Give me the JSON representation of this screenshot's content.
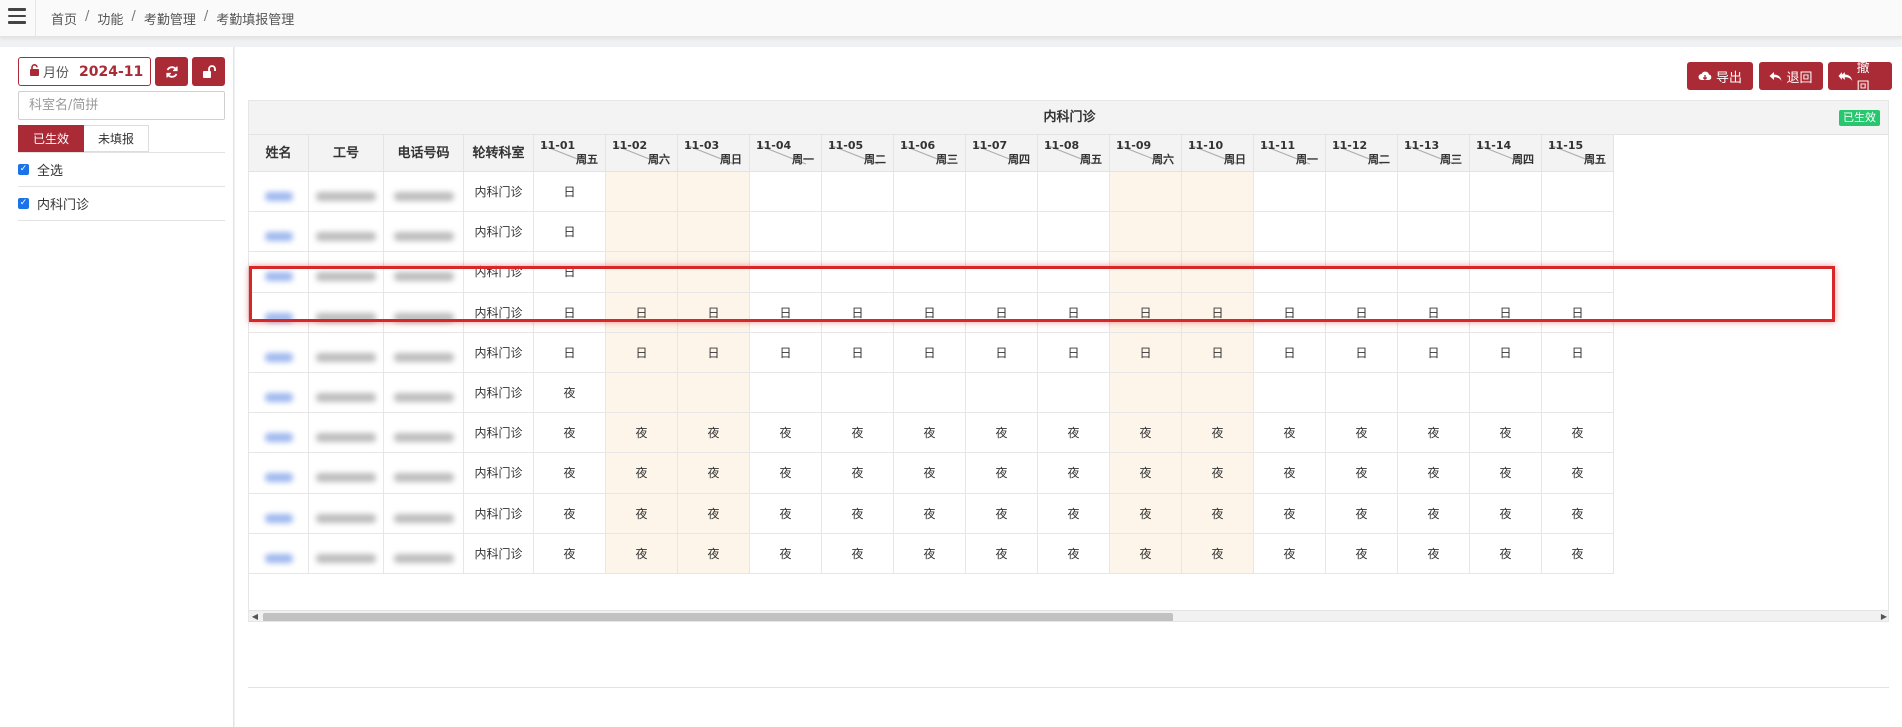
{
  "breadcrumb": [
    "首页",
    "功能",
    "考勤管理",
    "考勤填报管理"
  ],
  "sidebar": {
    "month_label": "月份",
    "month_value": "2024-11",
    "search_placeholder": "科室名/简拼",
    "tabs": [
      "已生效",
      "未填报"
    ],
    "checks": [
      "全选",
      "内科门诊"
    ]
  },
  "actions": {
    "export": "导出",
    "return": "退回",
    "revoke": "撤回"
  },
  "table": {
    "department": "内科门诊",
    "status_badge": "已生效",
    "fixed_headers": [
      "姓名",
      "工号",
      "电话号码",
      "轮转科室"
    ],
    "dates": [
      {
        "d": "11-01",
        "w": "周五"
      },
      {
        "d": "11-02",
        "w": "周六"
      },
      {
        "d": "11-03",
        "w": "周日"
      },
      {
        "d": "11-04",
        "w": "周一"
      },
      {
        "d": "11-05",
        "w": "周二"
      },
      {
        "d": "11-06",
        "w": "周三"
      },
      {
        "d": "11-07",
        "w": "周四"
      },
      {
        "d": "11-08",
        "w": "周五"
      },
      {
        "d": "11-09",
        "w": "周六"
      },
      {
        "d": "11-10",
        "w": "周日"
      },
      {
        "d": "11-11",
        "w": "周一"
      },
      {
        "d": "11-12",
        "w": "周二"
      },
      {
        "d": "11-13",
        "w": "周三"
      },
      {
        "d": "11-14",
        "w": "周四"
      },
      {
        "d": "11-15",
        "w": "周五"
      }
    ],
    "rows": [
      {
        "dept": "内科门诊",
        "shifts": [
          "日",
          "",
          "",
          "",
          "",
          "",
          "",
          "",
          "",
          "",
          "",
          "",
          "",
          "",
          ""
        ]
      },
      {
        "dept": "内科门诊",
        "shifts": [
          "日",
          "",
          "",
          "",
          "",
          "",
          "",
          "",
          "",
          "",
          "",
          "",
          "",
          "",
          ""
        ]
      },
      {
        "dept": "内科门诊",
        "shifts": [
          "日",
          "",
          "",
          "",
          "",
          "",
          "",
          "",
          "",
          "",
          "",
          "",
          "",
          "",
          ""
        ]
      },
      {
        "dept": "内科门诊",
        "shifts": [
          "日",
          "日",
          "日",
          "日",
          "日",
          "日",
          "日",
          "日",
          "日",
          "日",
          "日",
          "日",
          "日",
          "日",
          "日"
        ]
      },
      {
        "dept": "内科门诊",
        "shifts": [
          "日",
          "日",
          "日",
          "日",
          "日",
          "日",
          "日",
          "日",
          "日",
          "日",
          "日",
          "日",
          "日",
          "日",
          "日"
        ]
      },
      {
        "dept": "内科门诊",
        "shifts": [
          "夜",
          "",
          "",
          "",
          "",
          "",
          "",
          "",
          "",
          "",
          "",
          "",
          "",
          "",
          ""
        ]
      },
      {
        "dept": "内科门诊",
        "shifts": [
          "夜",
          "夜",
          "夜",
          "夜",
          "夜",
          "夜",
          "夜",
          "夜",
          "夜",
          "夜",
          "夜",
          "夜",
          "夜",
          "夜",
          "夜"
        ]
      },
      {
        "dept": "内科门诊",
        "shifts": [
          "夜",
          "夜",
          "夜",
          "夜",
          "夜",
          "夜",
          "夜",
          "夜",
          "夜",
          "夜",
          "夜",
          "夜",
          "夜",
          "夜",
          "夜"
        ]
      },
      {
        "dept": "内科门诊",
        "shifts": [
          "夜",
          "夜",
          "夜",
          "夜",
          "夜",
          "夜",
          "夜",
          "夜",
          "夜",
          "夜",
          "夜",
          "夜",
          "夜",
          "夜",
          "夜"
        ]
      },
      {
        "dept": "内科门诊",
        "shifts": [
          "夜",
          "夜",
          "夜",
          "夜",
          "夜",
          "夜",
          "夜",
          "夜",
          "夜",
          "夜",
          "夜",
          "夜",
          "夜",
          "夜",
          "夜"
        ]
      }
    ]
  },
  "colors": {
    "brand": "#aa2a35",
    "weekend": "#fdf5e9",
    "badge": "#28c76f",
    "highlight": "#d62828"
  }
}
